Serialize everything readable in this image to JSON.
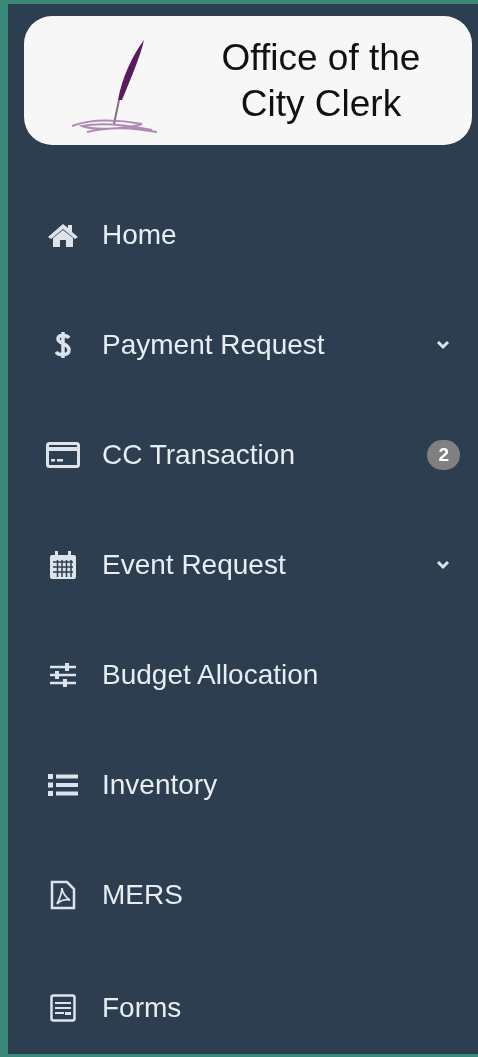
{
  "logo": {
    "title": "Office of the City Clerk"
  },
  "menu": [
    {
      "kind": "home",
      "label": "Home",
      "submenu": false
    },
    {
      "kind": "dollar",
      "label": "Payment Request",
      "submenu": true
    },
    {
      "kind": "card",
      "label": "CC Transaction",
      "submenu": false,
      "badge": "2"
    },
    {
      "kind": "calendar",
      "label": "Event Request",
      "submenu": true
    },
    {
      "kind": "sliders",
      "label": "Budget Allocation",
      "submenu": false
    },
    {
      "kind": "list",
      "label": "Inventory",
      "submenu": false
    },
    {
      "kind": "pdf",
      "label": "MERS",
      "submenu": false
    },
    {
      "kind": "form",
      "label": "Forms",
      "submenu": false
    }
  ]
}
